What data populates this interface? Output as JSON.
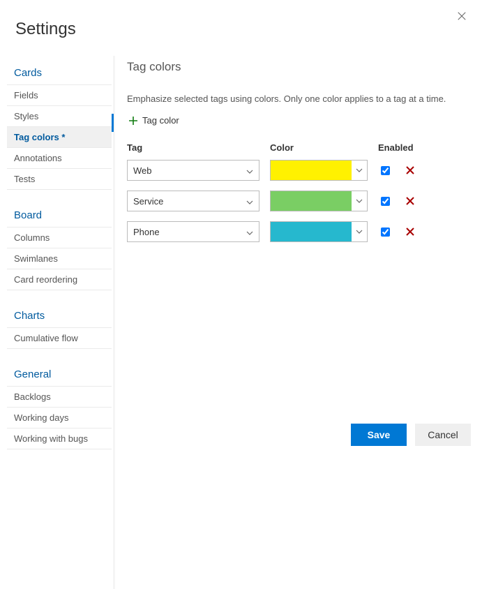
{
  "title": "Settings",
  "sidebar": {
    "sections": [
      {
        "header": "Cards",
        "items": [
          {
            "label": "Fields",
            "selected": false
          },
          {
            "label": "Styles",
            "selected": false
          },
          {
            "label": "Tag colors *",
            "selected": true
          },
          {
            "label": "Annotations",
            "selected": false
          },
          {
            "label": "Tests",
            "selected": false
          }
        ]
      },
      {
        "header": "Board",
        "items": [
          {
            "label": "Columns",
            "selected": false
          },
          {
            "label": "Swimlanes",
            "selected": false
          },
          {
            "label": "Card reordering",
            "selected": false
          }
        ]
      },
      {
        "header": "Charts",
        "items": [
          {
            "label": "Cumulative flow",
            "selected": false
          }
        ]
      },
      {
        "header": "General",
        "items": [
          {
            "label": "Backlogs",
            "selected": false
          },
          {
            "label": "Working days",
            "selected": false
          },
          {
            "label": "Working with bugs",
            "selected": false
          }
        ]
      }
    ]
  },
  "content": {
    "heading": "Tag colors",
    "description": "Emphasize selected tags using colors. Only one color applies to a tag at a time.",
    "add_label": "Tag color",
    "columns": {
      "tag": "Tag",
      "color": "Color",
      "enabled": "Enabled"
    },
    "rows": [
      {
        "tag": "Web",
        "color": "#fff100",
        "enabled": true
      },
      {
        "tag": "Service",
        "color": "#7ace64",
        "enabled": true
      },
      {
        "tag": "Phone",
        "color": "#26b8ce",
        "enabled": true
      }
    ]
  },
  "footer": {
    "save": "Save",
    "cancel": "Cancel"
  }
}
